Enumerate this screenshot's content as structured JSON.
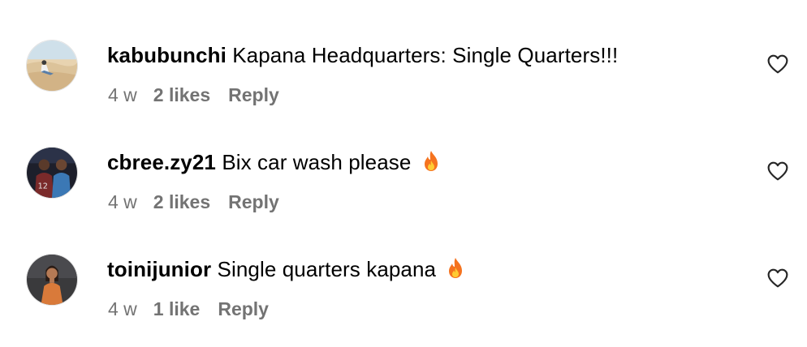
{
  "comments": [
    {
      "username": "kabubunchi",
      "text": "Kapana Headquarters: Single Quarters!!!",
      "emoji": "",
      "time": "4 w",
      "likes": "2 likes",
      "reply_label": "Reply"
    },
    {
      "username": "cbree.zy21",
      "text": "Bix car wash please",
      "emoji": "fire-emoji",
      "time": "4 w",
      "likes": "2 likes",
      "reply_label": "Reply"
    },
    {
      "username": "toinijunior",
      "text": "Single quarters kapana",
      "emoji": "fire-emoji",
      "time": "4 w",
      "likes": "1 like",
      "reply_label": "Reply"
    }
  ],
  "icons": {
    "like": "heart-outline-icon",
    "emoji": "fire-emoji"
  },
  "colors": {
    "text": "#000000",
    "meta": "#737373",
    "background": "#ffffff"
  }
}
